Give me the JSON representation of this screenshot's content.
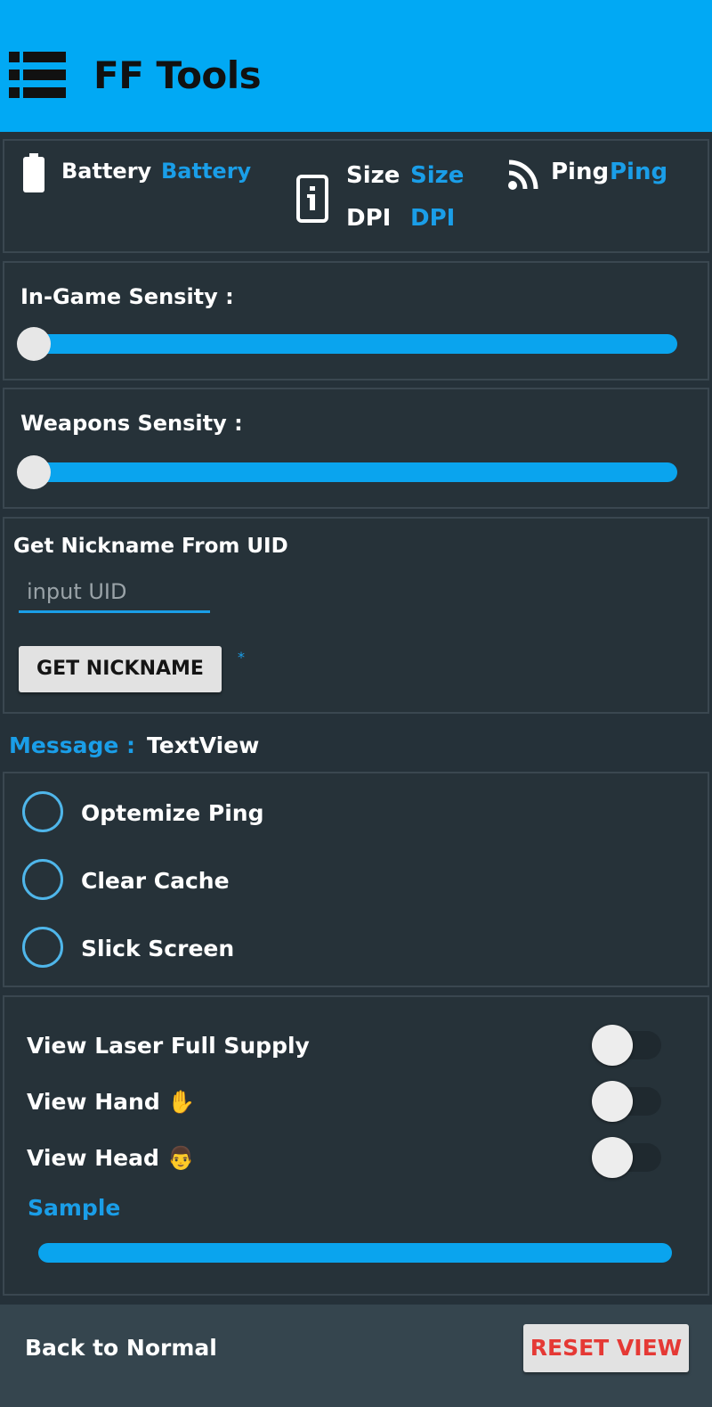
{
  "app": {
    "title": "FF Tools"
  },
  "status_card": {
    "battery_label": "Battery",
    "battery_value": "Battery",
    "size_label": "Size",
    "size_value": "Size",
    "dpi_label": "DPI",
    "dpi_value": "DPI",
    "ping_label": "Ping",
    "ping_value": "Ping"
  },
  "sensitivity": {
    "ingame_label": "In-Game Sensity :",
    "ingame_value": 0,
    "weapons_label": "Weapons Sensity :",
    "weapons_value": 0
  },
  "nickname": {
    "title": "Get Nickname From UID",
    "input_placeholder": "input UID",
    "button_label": "GET NICKNAME",
    "result_text": "*"
  },
  "message": {
    "label": "Message :",
    "value": "TextView"
  },
  "options": [
    {
      "label": "Optemize Ping",
      "selected": false
    },
    {
      "label": "Clear Cache",
      "selected": false
    },
    {
      "label": "Slick Screen",
      "selected": false
    }
  ],
  "view_toggles": [
    {
      "label": "View Laser Full Supply",
      "on": false
    },
    {
      "label": "View Hand ✋",
      "on": false
    },
    {
      "label": "View Head 👨",
      "on": false
    }
  ],
  "sample": {
    "label": "Sample",
    "value": 1.0
  },
  "bottom": {
    "label": "Back to Normal",
    "reset_label": "RESET VIEW"
  },
  "colors": {
    "accent": "#01a9f4",
    "value_text": "#1a9ee8",
    "reset_text": "#e53935",
    "background": "#253139"
  }
}
